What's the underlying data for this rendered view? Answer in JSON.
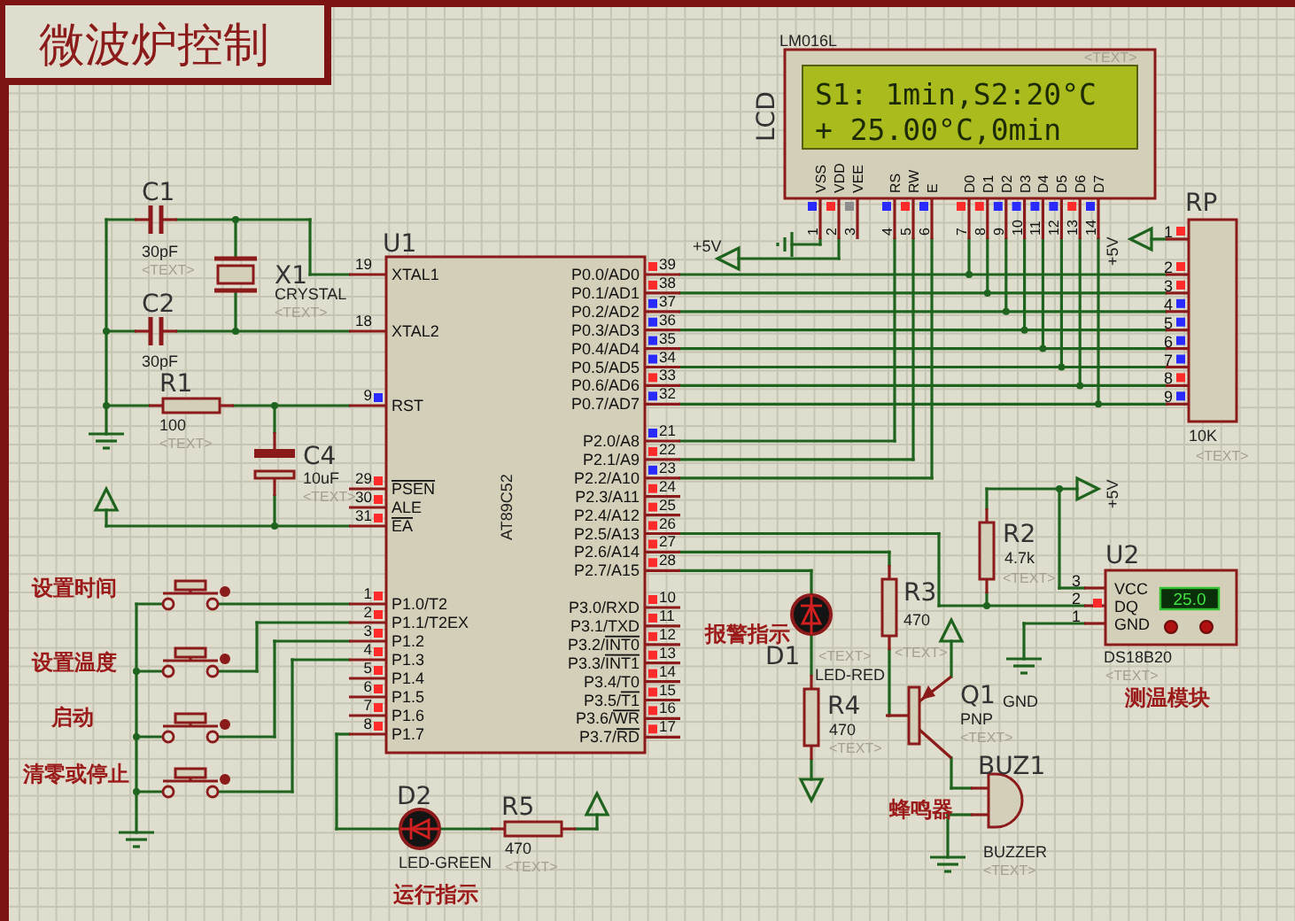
{
  "title": "微波炉控制",
  "mcu": {
    "ref": "U1",
    "part": "AT89C52",
    "left_pins": [
      {
        "number": "19",
        "name": "XTAL1"
      },
      {
        "number": "18",
        "name": "XTAL2"
      },
      {
        "number": "9",
        "name": "RST",
        "color": "#2a2aff"
      },
      {
        "number": "29",
        "inv": "PSEN",
        "color": "#ff2a2a"
      },
      {
        "number": "30",
        "name": "ALE",
        "color": "#ff2a2a"
      },
      {
        "number": "31",
        "inv": "EA",
        "color": "#ff2a2a"
      },
      {
        "number": "1",
        "name": "P1.0/T2",
        "color": "#ff2a2a"
      },
      {
        "number": "2",
        "name": "P1.1/T2EX",
        "color": "#ff2a2a"
      },
      {
        "number": "3",
        "name": "P1.2",
        "color": "#ff2a2a"
      },
      {
        "number": "4",
        "name": "P1.3",
        "color": "#ff2a2a"
      },
      {
        "number": "5",
        "name": "P1.4",
        "color": "#ff2a2a"
      },
      {
        "number": "6",
        "name": "P1.5",
        "color": "#ff2a2a"
      },
      {
        "number": "7",
        "name": "P1.6",
        "color": "#ff2a2a"
      },
      {
        "number": "8",
        "name": "P1.7",
        "color": "#ff2a2a"
      }
    ],
    "right_pins": [
      {
        "number": "39",
        "name": "P0.0/AD0",
        "color": "#ff2a2a"
      },
      {
        "number": "38",
        "name": "P0.1/AD1",
        "color": "#ff2a2a"
      },
      {
        "number": "37",
        "name": "P0.2/AD2",
        "color": "#2a2aff"
      },
      {
        "number": "36",
        "name": "P0.3/AD3",
        "color": "#2a2aff"
      },
      {
        "number": "35",
        "name": "P0.4/AD4",
        "color": "#2a2aff"
      },
      {
        "number": "34",
        "name": "P0.5/AD5",
        "color": "#2a2aff"
      },
      {
        "number": "33",
        "name": "P0.6/AD6",
        "color": "#ff2a2a"
      },
      {
        "number": "32",
        "name": "P0.7/AD7",
        "color": "#2a2aff"
      },
      {
        "number": "21",
        "name": "P2.0/A8",
        "color": "#2a2aff"
      },
      {
        "number": "22",
        "name": "P2.1/A9",
        "color": "#ff2a2a"
      },
      {
        "number": "23",
        "name": "P2.2/A10",
        "color": "#2a2aff"
      },
      {
        "number": "24",
        "name": "P2.3/A11",
        "color": "#ff2a2a"
      },
      {
        "number": "25",
        "name": "P2.4/A12",
        "color": "#ff2a2a"
      },
      {
        "number": "26",
        "name": "P2.5/A13",
        "color": "#ff2a2a"
      },
      {
        "number": "27",
        "name": "P2.6/A14",
        "color": "#ff2a2a"
      },
      {
        "number": "28",
        "name": "P2.7/A15",
        "color": "#ff2a2a"
      },
      {
        "number": "10",
        "name": "P3.0/RXD",
        "color": "#ff2a2a"
      },
      {
        "number": "11",
        "name": "P3.1/TXD",
        "color": "#ff2a2a"
      },
      {
        "number": "12",
        "name": "P3.2/",
        "inv": "INT0",
        "color": "#ff2a2a"
      },
      {
        "number": "13",
        "name": "P3.3/",
        "inv": "INT1",
        "color": "#ff2a2a"
      },
      {
        "number": "14",
        "name": "P3.4/T0",
        "color": "#ff2a2a"
      },
      {
        "number": "15",
        "name": "P3.5/",
        "inv": "T1",
        "color": "#ff2a2a"
      },
      {
        "number": "16",
        "name": "P3.6/",
        "inv": "WR",
        "color": "#ff2a2a"
      },
      {
        "number": "17",
        "name": "P3.7/",
        "inv": "RD",
        "color": "#ff2a2a"
      }
    ]
  },
  "lcd": {
    "ref": "LCD",
    "part": "LM016L",
    "tag": "<TEXT>",
    "lines": [
      "S1: 1min,S2:20°C",
      "+ 25.00°C,0min"
    ],
    "pins": [
      {
        "number": "1",
        "name": "VSS",
        "color": "#2a2aff"
      },
      {
        "number": "2",
        "name": "VDD",
        "color": "#ff2a2a"
      },
      {
        "number": "3",
        "name": "VEE",
        "color": "#8c8c8c"
      },
      {
        "number": "4",
        "name": "RS",
        "color": "#2a2aff"
      },
      {
        "number": "5",
        "name": "RW",
        "color": "#ff2a2a"
      },
      {
        "number": "6",
        "name": "E",
        "color": "#2a2aff"
      },
      {
        "number": "7",
        "name": "D0",
        "color": "#ff2a2a"
      },
      {
        "number": "8",
        "name": "D1",
        "color": "#ff2a2a"
      },
      {
        "number": "9",
        "name": "D2",
        "color": "#2a2aff"
      },
      {
        "number": "10",
        "name": "D3",
        "color": "#2a2aff"
      },
      {
        "number": "11",
        "name": "D4",
        "color": "#2a2aff"
      },
      {
        "number": "12",
        "name": "D5",
        "color": "#2a2aff"
      },
      {
        "number": "13",
        "name": "D6",
        "color": "#ff2a2a"
      },
      {
        "number": "14",
        "name": "D7",
        "color": "#2a2aff"
      }
    ]
  },
  "resistor_pack": {
    "ref": "RP",
    "value": "10K",
    "tag": "<TEXT>",
    "pins": [
      {
        "number": "1",
        "color": "#ff2a2a"
      },
      {
        "number": "2",
        "color": "#ff2a2a"
      },
      {
        "number": "3",
        "color": "#ff2a2a"
      },
      {
        "number": "4",
        "color": "#2a2aff"
      },
      {
        "number": "5",
        "color": "#2a2aff"
      },
      {
        "number": "6",
        "color": "#2a2aff"
      },
      {
        "number": "7",
        "color": "#2a2aff"
      },
      {
        "number": "8",
        "color": "#ff2a2a"
      },
      {
        "number": "9",
        "color": "#2a2aff"
      }
    ]
  },
  "parts": [
    {
      "kind": "capacitor",
      "ref": "C1",
      "value": "30pF",
      "tag": "<TEXT>"
    },
    {
      "kind": "crystal",
      "ref": "X1",
      "value": "CRYSTAL",
      "tag": "<TEXT>"
    },
    {
      "kind": "capacitor",
      "ref": "C2",
      "value": "30pF"
    },
    {
      "kind": "resistor",
      "ref": "R1",
      "value": "100",
      "tag": "<TEXT>"
    },
    {
      "kind": "polar_capacitor",
      "ref": "C4",
      "value": "10uF",
      "tag": "<TEXT>"
    },
    {
      "kind": "resistor",
      "ref": "R2",
      "value": "4.7k",
      "tag": "<TEXT>"
    },
    {
      "kind": "resistor",
      "ref": "R3",
      "value": "470",
      "tag": "<TEXT>"
    },
    {
      "kind": "led",
      "ref": "D1",
      "value": "LED-RED",
      "tag": "<TEXT>",
      "caption": "报警指示"
    },
    {
      "kind": "resistor",
      "ref": "R4",
      "value": "470",
      "tag": "<TEXT>"
    },
    {
      "kind": "pnp_transistor",
      "ref": "Q1",
      "value": "PNP",
      "tag": "<TEXT>"
    },
    {
      "kind": "buzzer",
      "ref": "BUZ1",
      "value": "BUZZER",
      "tag": "<TEXT>",
      "caption": "蜂鸣器"
    },
    {
      "kind": "led",
      "ref": "D2",
      "value": "LED-GREEN",
      "caption": "运行指示"
    },
    {
      "kind": "resistor",
      "ref": "R5",
      "value": "470",
      "tag": "<TEXT>"
    }
  ],
  "buttons": [
    {
      "label": "设置时间"
    },
    {
      "label": "设置温度"
    },
    {
      "label": "启动"
    },
    {
      "label": "清零或停止"
    }
  ],
  "sensor": {
    "ref": "U2",
    "part": "DS18B20",
    "tag": "<TEXT>",
    "reading": "25.0",
    "ground_label": "GND",
    "caption": "测温模块",
    "pins": [
      {
        "number": "3",
        "name": "VCC"
      },
      {
        "number": "2",
        "name": "DQ",
        "color": "#ff2a2a"
      },
      {
        "number": "1",
        "name": "GND"
      }
    ]
  },
  "supply_labels": [
    "+5V",
    "+5V",
    "+5V"
  ]
}
